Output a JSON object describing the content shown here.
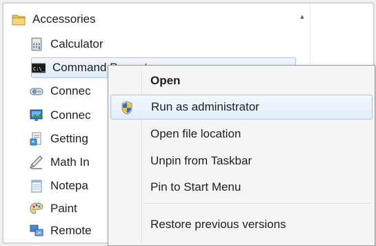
{
  "programs": {
    "folder": {
      "label": "Accessories",
      "icon": "folder-icon"
    },
    "items": [
      {
        "label": "Calculator",
        "icon": "calculator-icon"
      },
      {
        "label": "Command Prompt",
        "icon": "command-prompt-icon"
      },
      {
        "label": "Connec",
        "icon": "connect-projector-icon"
      },
      {
        "label": "Connec",
        "icon": "remote-connect-icon"
      },
      {
        "label": "Getting",
        "icon": "getting-started-icon"
      },
      {
        "label": "Math In",
        "icon": "math-input-icon"
      },
      {
        "label": "Notepa",
        "icon": "notepad-icon"
      },
      {
        "label": "Paint",
        "icon": "paint-icon"
      },
      {
        "label": "Remote",
        "icon": "remote-desktop-icon"
      }
    ]
  },
  "context_menu": {
    "items": [
      {
        "label": "Open",
        "bold": true
      },
      {
        "label": "Run as administrator",
        "icon": "uac-shield-icon",
        "highlighted": true
      },
      {
        "label": "Open file location"
      },
      {
        "label": "Unpin from Taskbar"
      },
      {
        "label": "Pin to Start Menu"
      },
      {
        "label": "Restore previous versions"
      }
    ]
  },
  "colors": {
    "highlight_border": "#a8c4e8",
    "menu_background": "#f5f5f5"
  }
}
